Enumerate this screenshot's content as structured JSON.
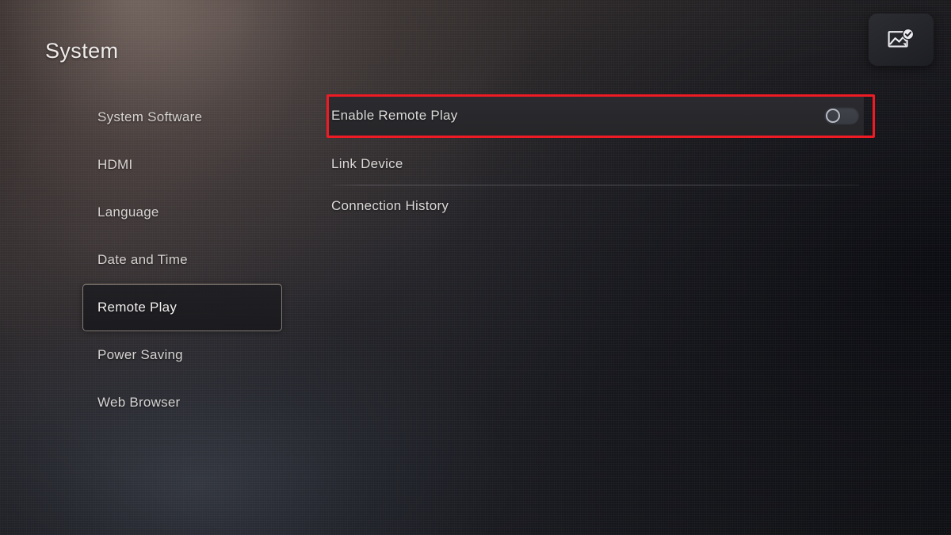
{
  "header": {
    "title": "System",
    "notification": {
      "icon": "screenshot-saved-icon",
      "label": "Screenshot Saved"
    }
  },
  "sidebar": {
    "items": [
      {
        "label": "System Software",
        "selected": false
      },
      {
        "label": "HDMI",
        "selected": false
      },
      {
        "label": "Language",
        "selected": false
      },
      {
        "label": "Date and Time",
        "selected": false
      },
      {
        "label": "Remote Play",
        "selected": true
      },
      {
        "label": "Power Saving",
        "selected": false
      },
      {
        "label": "Web Browser",
        "selected": false
      }
    ]
  },
  "main": {
    "section": "Remote Play",
    "rows": [
      {
        "label": "Enable Remote Play",
        "control": "toggle",
        "toggle_state": "off",
        "highlighted": true,
        "separator_after": false
      },
      {
        "label": "Link Device",
        "control": "none",
        "highlighted": false,
        "separator_after": true
      },
      {
        "label": "Connection History",
        "control": "none",
        "highlighted": false,
        "separator_after": false
      }
    ]
  },
  "annotation": {
    "target": "Enable Remote Play",
    "color": "#ee1b24",
    "shape": "rectangle"
  },
  "colors": {
    "annotation_red": "#ee1b24",
    "selected_border": "#c4bab0",
    "text_primary": "#efeceb",
    "text_secondary": "#d6d3d1",
    "toggle_off_track": "#3a3c44",
    "toggle_knob": "#b9bbc4",
    "row_highlight_bg": "#2b2b30"
  }
}
